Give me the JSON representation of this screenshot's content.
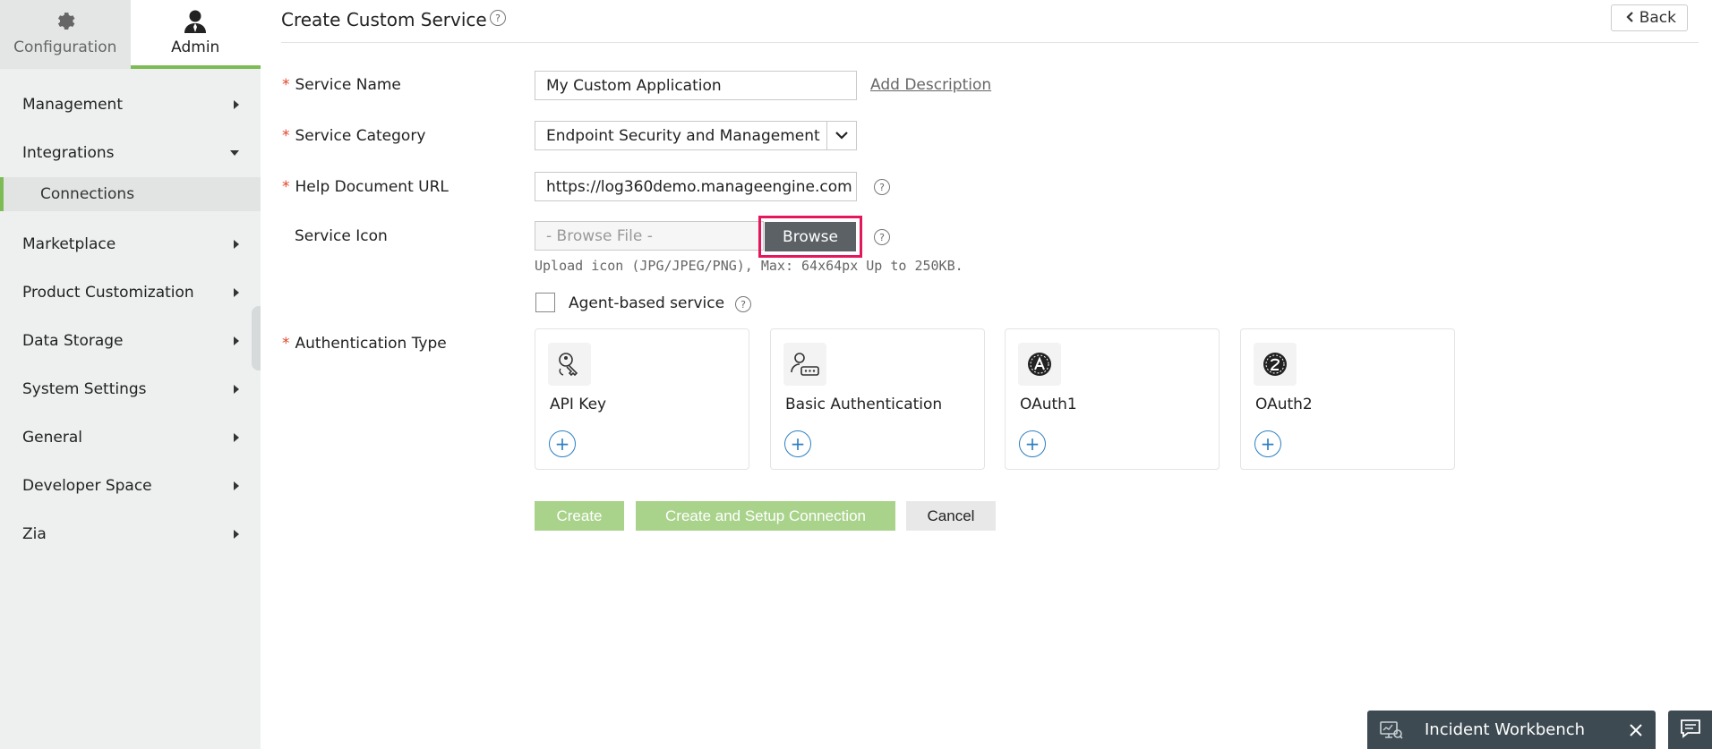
{
  "sidebar": {
    "tabs": [
      {
        "label": "Configuration",
        "icon": "gear-icon",
        "active": false
      },
      {
        "label": "Admin",
        "icon": "user-icon",
        "active": true
      }
    ],
    "items": [
      {
        "label": "Management",
        "expanded": false
      },
      {
        "label": "Integrations",
        "expanded": true
      },
      {
        "label": "Marketplace",
        "expanded": false
      },
      {
        "label": "Product Customization",
        "expanded": false
      },
      {
        "label": "Data Storage",
        "expanded": false
      },
      {
        "label": "System Settings",
        "expanded": false
      },
      {
        "label": "General",
        "expanded": false
      },
      {
        "label": "Developer Space",
        "expanded": false
      },
      {
        "label": "Zia",
        "expanded": false
      }
    ],
    "subitem": {
      "label": "Connections"
    }
  },
  "header": {
    "title": "Create Custom Service",
    "help": "?",
    "back_label": "Back"
  },
  "form": {
    "required_mark": "*",
    "service_name": {
      "label": "Service Name",
      "value": "My Custom Application",
      "add_description": "Add Description"
    },
    "service_category": {
      "label": "Service Category",
      "value": "Endpoint Security and Management"
    },
    "help_url": {
      "label": "Help Document URL",
      "value": "https://log360demo.manageengine.com"
    },
    "service_icon": {
      "label": "Service Icon",
      "placeholder": "- Browse File -",
      "browse_label": "Browse",
      "hint": "Upload icon (JPG/JPEG/PNG), Max: 64x64px Up to 250KB."
    },
    "agent_based": {
      "label": "Agent-based service",
      "checked": false
    },
    "auth_type": {
      "label": "Authentication Type",
      "options": [
        {
          "label": "API Key",
          "icon": "key-icon",
          "add": "+"
        },
        {
          "label": "Basic Authentication",
          "icon": "user-password-icon",
          "add": "+"
        },
        {
          "label": "OAuth1",
          "icon": "oauth1-icon",
          "add": "+"
        },
        {
          "label": "OAuth2",
          "icon": "oauth2-icon",
          "add": "+"
        }
      ]
    },
    "buttons": {
      "create": "Create",
      "create_setup": "Create and Setup Connection",
      "cancel": "Cancel"
    }
  },
  "workbench": {
    "label": "Incident Workbench"
  },
  "colors": {
    "accent": "#7dbb54",
    "highlight": "#e3175b",
    "dark_bar": "#3d4a52",
    "link_blue": "#2d7fc1"
  }
}
